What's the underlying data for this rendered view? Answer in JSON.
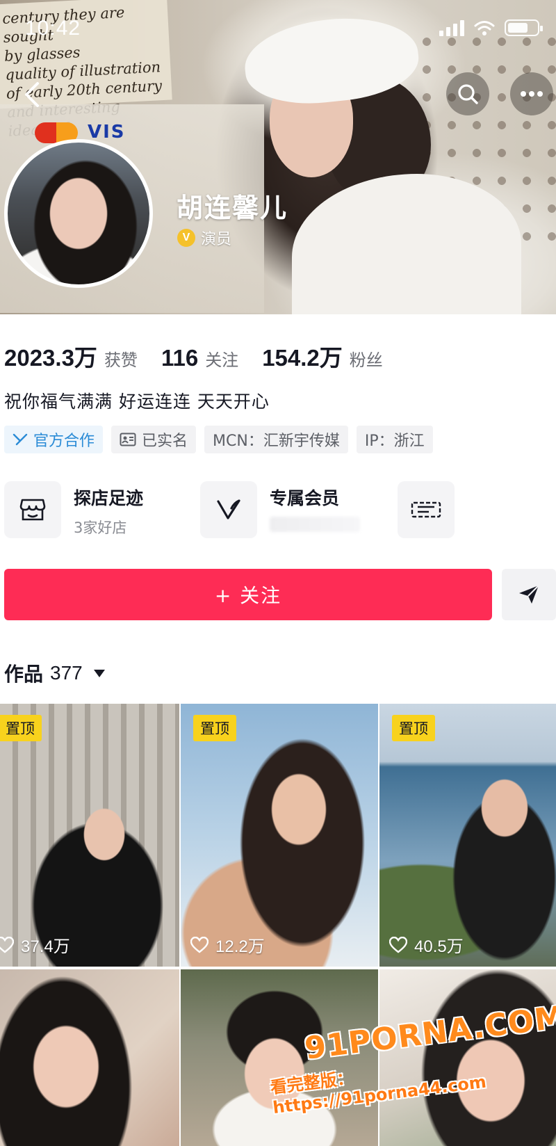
{
  "status_bar": {
    "time": "10:42"
  },
  "profile": {
    "nickname": "胡连馨儿",
    "verify_label": "演员",
    "stats": [
      {
        "value": "2023.3万",
        "label": "获赞"
      },
      {
        "value": "116",
        "label": "关注"
      },
      {
        "value": "154.2万",
        "label": "粉丝"
      }
    ],
    "bio": "祝你福气满满 好运连连 天天开心",
    "tags": [
      "官方合作",
      "已实名",
      "MCN：汇新宇传媒",
      "IP：浙江"
    ]
  },
  "shortcuts": [
    {
      "title": "探店足迹",
      "subtitle": "3家好店"
    },
    {
      "title": "专属会员",
      "subtitle": ""
    }
  ],
  "actions": {
    "follow_label": "+ 关注"
  },
  "works": {
    "title": "作品",
    "count": "377",
    "items": [
      {
        "pinned": "置顶",
        "likes": "37.4万"
      },
      {
        "pinned": "置顶",
        "likes": "12.2万"
      },
      {
        "pinned": "置顶",
        "likes": "40.5万"
      },
      {
        "pinned": "",
        "likes": ""
      },
      {
        "pinned": "",
        "likes": ""
      },
      {
        "pinned": "",
        "likes": ""
      }
    ]
  },
  "watermark": {
    "logo": "91PORNA.COM",
    "text": "看完整版：https://91porna44.com"
  },
  "cover_text": "century they are sought by glasses quality of illustration of early 20th century and interesting ideal gift.",
  "colors": {
    "accent": "#fe2c55",
    "pin": "#f8d21d",
    "official": "#2a8bd6",
    "verified": "#f5c12a"
  },
  "icons": [
    "back-icon",
    "search-icon",
    "more-icon",
    "store-icon",
    "vip-icon",
    "share-icon",
    "heart-icon",
    "caret-down-icon"
  ]
}
